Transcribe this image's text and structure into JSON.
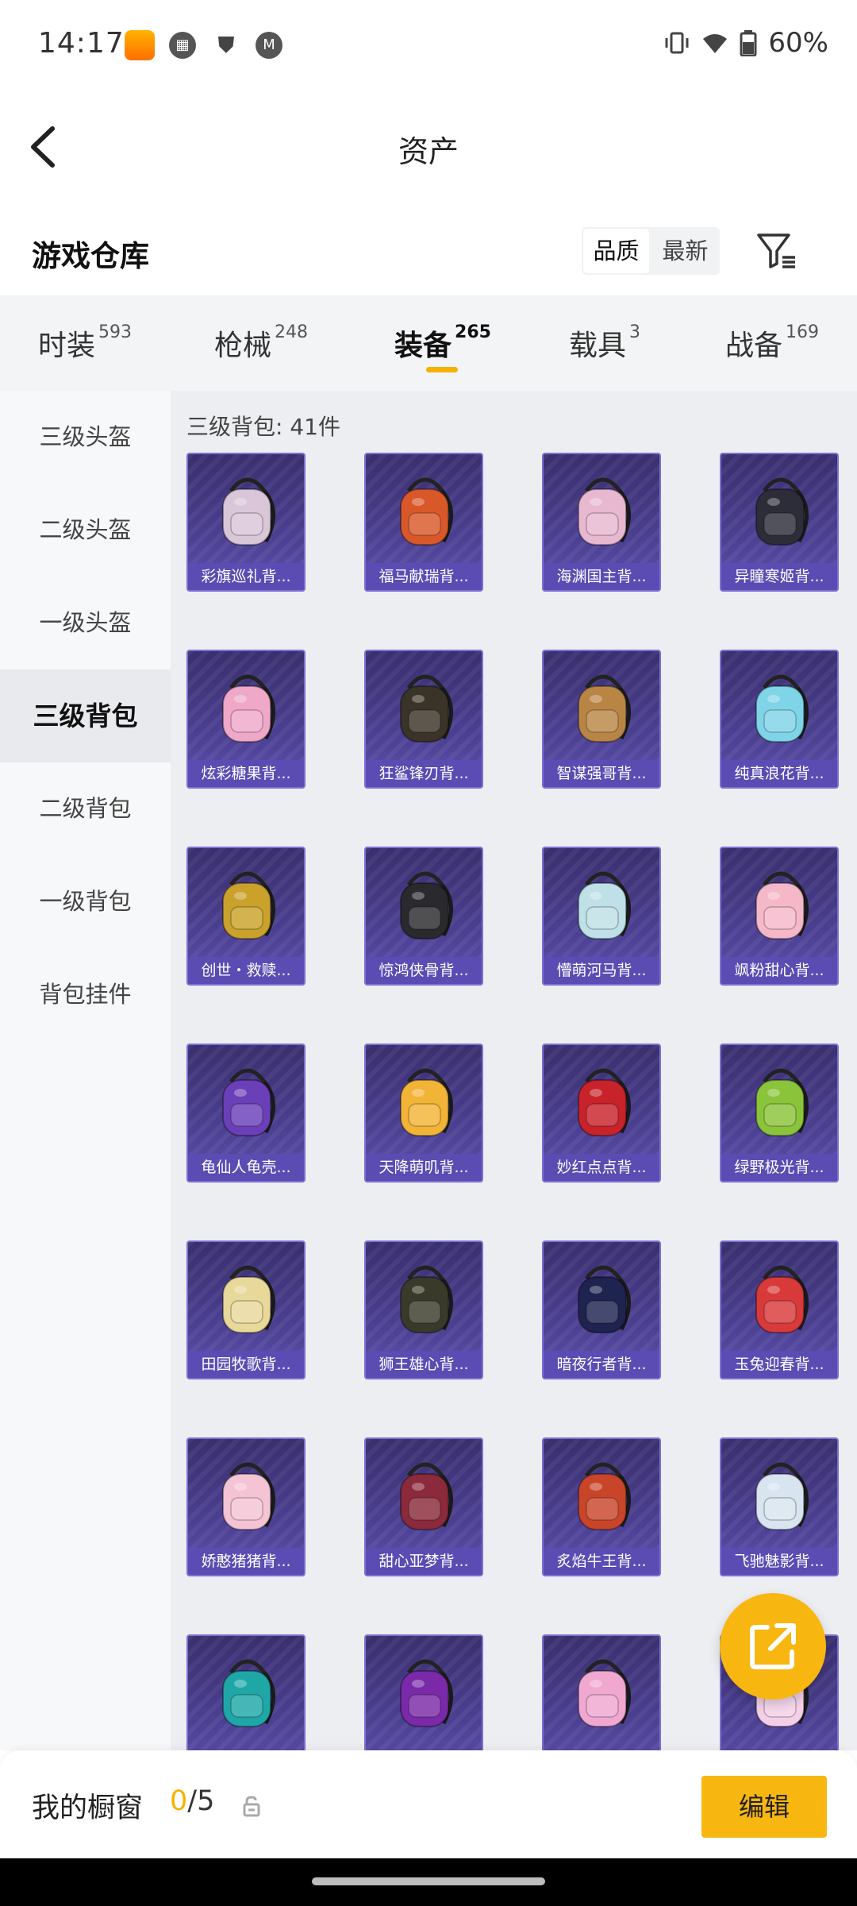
{
  "status_bar": {
    "time": "14:17",
    "battery": "60%"
  },
  "header": {
    "title": "资产"
  },
  "warehouse": {
    "title": "游戏仓库",
    "sort_options": [
      "品质",
      "最新"
    ]
  },
  "category_tabs": [
    {
      "label": "时装",
      "count": "593"
    },
    {
      "label": "枪械",
      "count": "248"
    },
    {
      "label": "装备",
      "count": "265",
      "active": true
    },
    {
      "label": "载具",
      "count": "3"
    },
    {
      "label": "战备",
      "count": "169"
    }
  ],
  "sidebar": {
    "items": [
      "三级头盔",
      "二级头盔",
      "一级头盔",
      "三级背包",
      "二级背包",
      "一级背包",
      "背包挂件"
    ],
    "active_index": 3
  },
  "content": {
    "count_text": "三级背包: 41件",
    "items": [
      "彩旗巡礼背...",
      "福马献瑞背...",
      "海渊国主背...",
      "异瞳寒姬背...",
      "炫彩糖果背...",
      "狂鲨锋刃背...",
      "智谋强哥背...",
      "纯真浪花背...",
      "创世・救赎...",
      "惊鸿侠骨背...",
      "懵萌河马背...",
      "飒粉甜心背...",
      "龟仙人龟壳...",
      "天降萌叽背...",
      "妙红点点背...",
      "绿野极光背...",
      "田园牧歌背...",
      "狮王雄心背...",
      "暗夜行者背...",
      "玉兔迎春背...",
      "娇憨猪猪背...",
      "甜心亚梦背...",
      "炙焰牛王背...",
      "飞驰魅影背...",
      "",
      "",
      "",
      ""
    ],
    "item_colors": [
      "#d9c6d8",
      "#d8582a",
      "#e7b8d0",
      "#2d2d3a",
      "#f0a8c8",
      "#3a3328",
      "#b98545",
      "#7fd4e8",
      "#caa12a",
      "#2a2a2e",
      "#bfe0e6",
      "#f4b8c8",
      "#6a3fb8",
      "#f2b436",
      "#c8222a",
      "#8ac43a",
      "#e8d89a",
      "#3a3a2a",
      "#1e2350",
      "#d83a3a",
      "#f4c4d4",
      "#8a2a3a",
      "#c8452a",
      "#d8e4f0",
      "#1fa7a8",
      "#7a2aa8",
      "#f0a8d0",
      "#f4d0e8"
    ]
  },
  "bottom_bar": {
    "label": "我的橱窗",
    "count_used": "0",
    "count_total": "/5",
    "edit_label": "编辑"
  }
}
